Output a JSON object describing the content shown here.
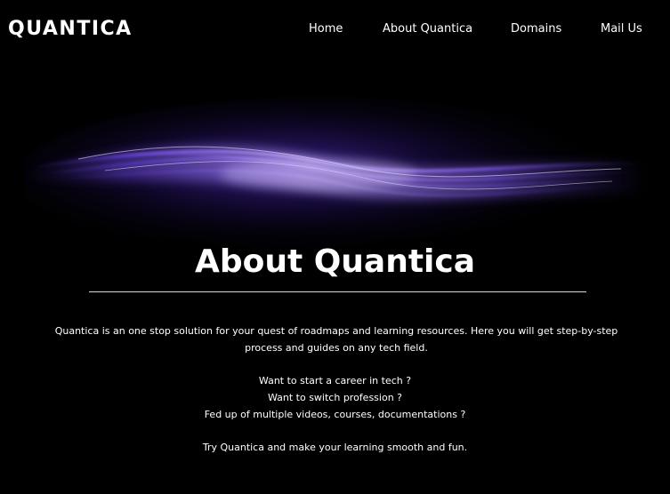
{
  "header": {
    "logo": "QUANTICA",
    "nav": [
      {
        "label": "Home"
      },
      {
        "label": "About Quantica"
      },
      {
        "label": "Domains"
      },
      {
        "label": "Mail Us"
      }
    ]
  },
  "main": {
    "title": "About Quantica",
    "intro": "Quantica is an one stop solution for your quest of roadmaps and learning resources. Here you will get step-by-step process and guides on any tech field.",
    "questions": [
      "Want to start a career in tech ?",
      "Want to switch profession ?",
      "Fed up of multiple videos, courses, documentations ?"
    ],
    "closing": "Try Quantica and make your learning smooth and fun."
  },
  "colors": {
    "background": "#000000",
    "text": "#ffffff",
    "accent": "#7a4bff"
  },
  "icons": {
    "hero": "purple-light-wave-image"
  }
}
